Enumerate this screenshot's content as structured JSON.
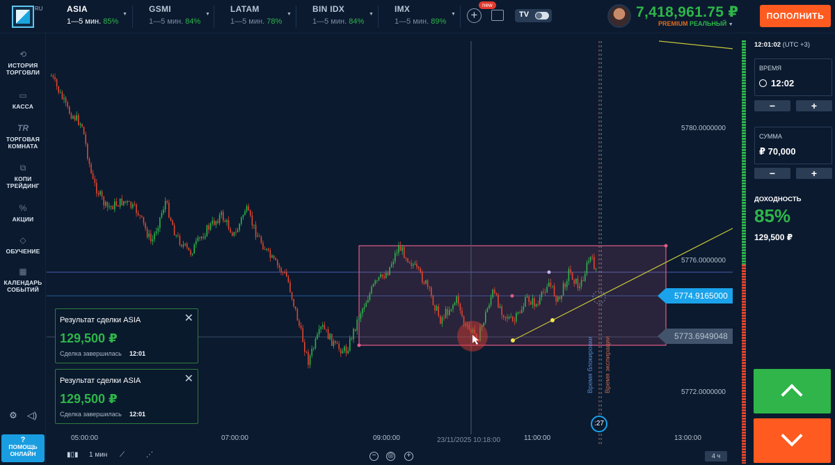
{
  "header": {
    "logo_suffix": "RU",
    "assets": [
      {
        "name": "ASIA",
        "timeframe": "1—5 мин.",
        "payout": "85%"
      },
      {
        "name": "GSMI",
        "timeframe": "1—5 мин.",
        "payout": "84%"
      },
      {
        "name": "LATAM",
        "timeframe": "1—5 мин.",
        "payout": "78%"
      },
      {
        "name": "BIN IDX",
        "timeframe": "1—5 мин.",
        "payout": "84%"
      },
      {
        "name": "IMX",
        "timeframe": "1—5 мин.",
        "payout": "89%"
      }
    ],
    "new_badge": "new",
    "tv_label": "TV",
    "balance": "7,418,961.75 ₽",
    "account_premium": "PREMIUM",
    "account_type": "РЕАЛЬНЫЙ",
    "deposit_label": "ПОПОЛНИТЬ"
  },
  "sidebar": {
    "items": [
      {
        "label": "ИСТОРИЯ\nТОРГОВЛИ",
        "icon": "history-icon"
      },
      {
        "label": "КАССА",
        "icon": "wallet-icon"
      },
      {
        "label": "ТОРГОВАЯ\nКОМНАТА",
        "icon": "trading-room-icon"
      },
      {
        "label": "КОПИ\nТРЕЙДИНГ",
        "icon": "copy-trading-icon"
      },
      {
        "label": "АКЦИИ",
        "icon": "promo-icon"
      },
      {
        "label": "ОБУЧЕНИЕ",
        "icon": "education-icon"
      },
      {
        "label": "КАЛЕНДАРЬ\nСОБЫТИЙ",
        "icon": "calendar-icon"
      }
    ],
    "settings_icon": "gear-icon",
    "sound_icon": "speaker-icon",
    "help_label": "ПОМОЩЬ\nОНЛАЙН"
  },
  "chart": {
    "current_price": "5774.9165000",
    "line_price": "5773.6949048",
    "y_labels": [
      "5780.0000000",
      "5776.0000000",
      "5772.0000000"
    ],
    "x_labels": [
      "05:00:00",
      "07:00:00",
      "09:00:00",
      "11:00:00",
      "13:00:00"
    ],
    "crosshair_date": "23/11/2025 10:18:00",
    "purchase_deadline_label": "Время блокировки",
    "expiry_label": "Время экспирации",
    "timer": ":27",
    "colors": {
      "bull": "#2fb54a",
      "bear": "#e2462e",
      "rect": "#e35c86",
      "trend": "#c8c83a",
      "hline": "#5a6fd0"
    }
  },
  "toasts": [
    {
      "title": "Результат сделки ASIA",
      "amount": "129,500 ₽",
      "status": "Сделка завершилась",
      "time": "12:01"
    },
    {
      "title": "Результат сделки ASIA",
      "amount": "129,500 ₽",
      "status": "Сделка завершилась",
      "time": "12:01"
    }
  ],
  "bottombar": {
    "timeframe": "1 мин",
    "period": "4 ч"
  },
  "panel": {
    "clock": "12:01:02",
    "timezone": "(UTC +3)",
    "time_label": "ВРЕМЯ",
    "time_value": "12:02",
    "amount_label": "СУММА",
    "amount_value": "₽ 70,000",
    "minus": "−",
    "plus": "+",
    "profit_label": "ДОХОДНОСТЬ",
    "profit_pct": "85%",
    "profit_amount": "129,500 ₽"
  }
}
